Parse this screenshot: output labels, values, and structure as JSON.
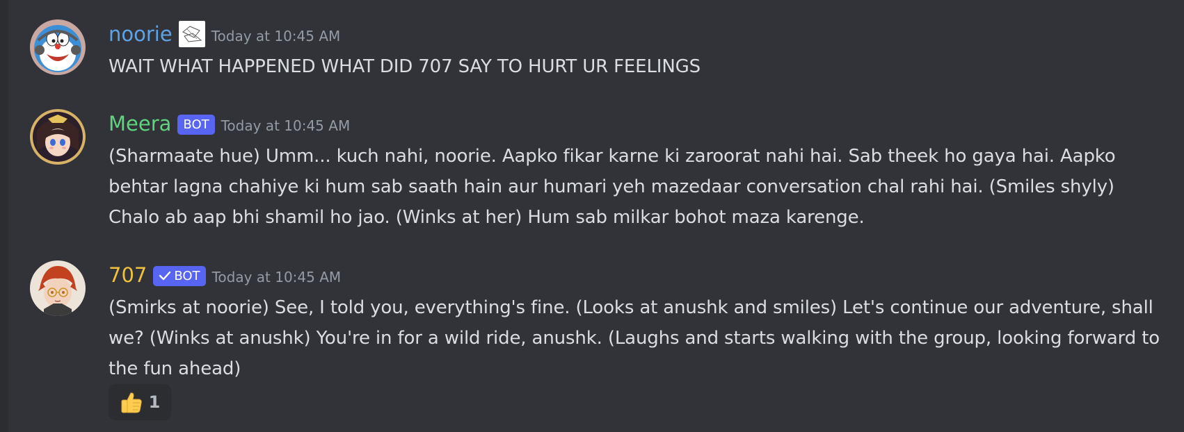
{
  "messages": [
    {
      "username": "noorie",
      "username_color": "#5ea3e6",
      "timestamp": "Today at 10:45 AM",
      "text": "WAIT WHAT HAPPENED WHAT DID 707 SAY TO HURT UR FEELINGS",
      "avatar_icon": "doraemon-avatar"
    },
    {
      "username": "Meera",
      "username_color": "#5fd37d",
      "bot_tag": "BOT",
      "timestamp": "Today at 10:45 AM",
      "text": "(Sharmaate hue) Umm... kuch nahi, noorie. Aapko fikar karne ki zaroorat nahi hai. Sab theek ho gaya hai. Aapko behtar lagna chahiye ki hum sab saath hain aur humari yeh mazedaar conversation chal rahi hai. (Smiles shyly) Chalo ab aap bhi shamil ho jao. (Winks at her) Hum sab milkar bohot maza karenge.",
      "avatar_icon": "anime-girl-avatar"
    },
    {
      "username": "707",
      "username_color": "#f0c23b",
      "bot_tag": "BOT",
      "verified": true,
      "timestamp": "Today at 10:45 AM",
      "text": "(Smirks at noorie) See, I told you, everything's fine. (Looks at anushk and smiles) Let's continue our adventure, shall we? (Winks at anushk) You're in for a wild ride, anushk. (Laughs and starts walking with the group, looking forward to the fun ahead)",
      "avatar_icon": "red-hair-boy-avatar",
      "reaction": {
        "emoji": "thumbs-up",
        "count": "1"
      }
    }
  ],
  "colors": {
    "background": "#313338",
    "text": "#dbdee1",
    "timestamp": "#949ba4",
    "bot_tag": "#5865f2"
  }
}
